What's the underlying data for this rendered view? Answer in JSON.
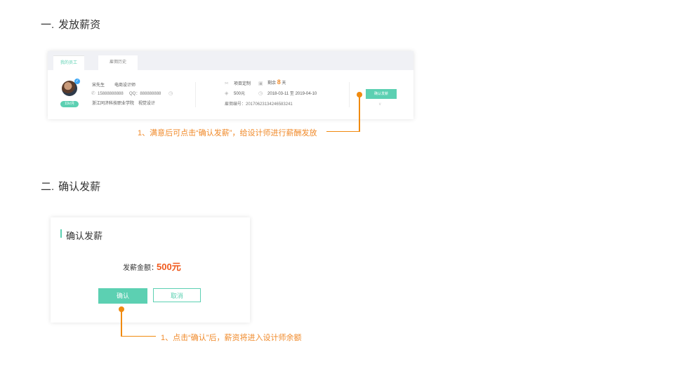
{
  "section1": {
    "number": "一.",
    "title": "发放薪资"
  },
  "section2": {
    "number": "二.",
    "title": "确认发薪"
  },
  "card1": {
    "tabs": [
      {
        "label": "我的员工"
      },
      {
        "label": "雇佣历史"
      }
    ],
    "employee": {
      "name": "宋先生",
      "role": "电商设计师",
      "phone": "15888888888",
      "qq": "QQ：888888888",
      "school": "浙江同济科技职业学院",
      "major": "视觉设计",
      "salary_badge": "11k/月"
    },
    "project": {
      "type": "项目定制",
      "remaining_prefix": "剩余",
      "remaining_days": "8",
      "remaining_suffix": "天",
      "amount": "500元",
      "period": "2018-03-11 至 2019-04-10",
      "hire_no": "雇佣编号：20170623134246583241"
    },
    "confirm_button": "确认发薪"
  },
  "annotation1": "1、满意后可点击“确认发薪”，给设计师进行薪酬发放",
  "dialog": {
    "title": "确认发薪",
    "amount_label": "发薪金额：",
    "amount_value": "500元",
    "confirm_label": "确认",
    "cancel_label": "取消"
  },
  "annotation2": "1、点击“确认”后，薪资将进入设计师余额",
  "colors": {
    "accent": "#5cd0b2",
    "annotation": "#f08a10",
    "amount": "#f05a1e"
  }
}
